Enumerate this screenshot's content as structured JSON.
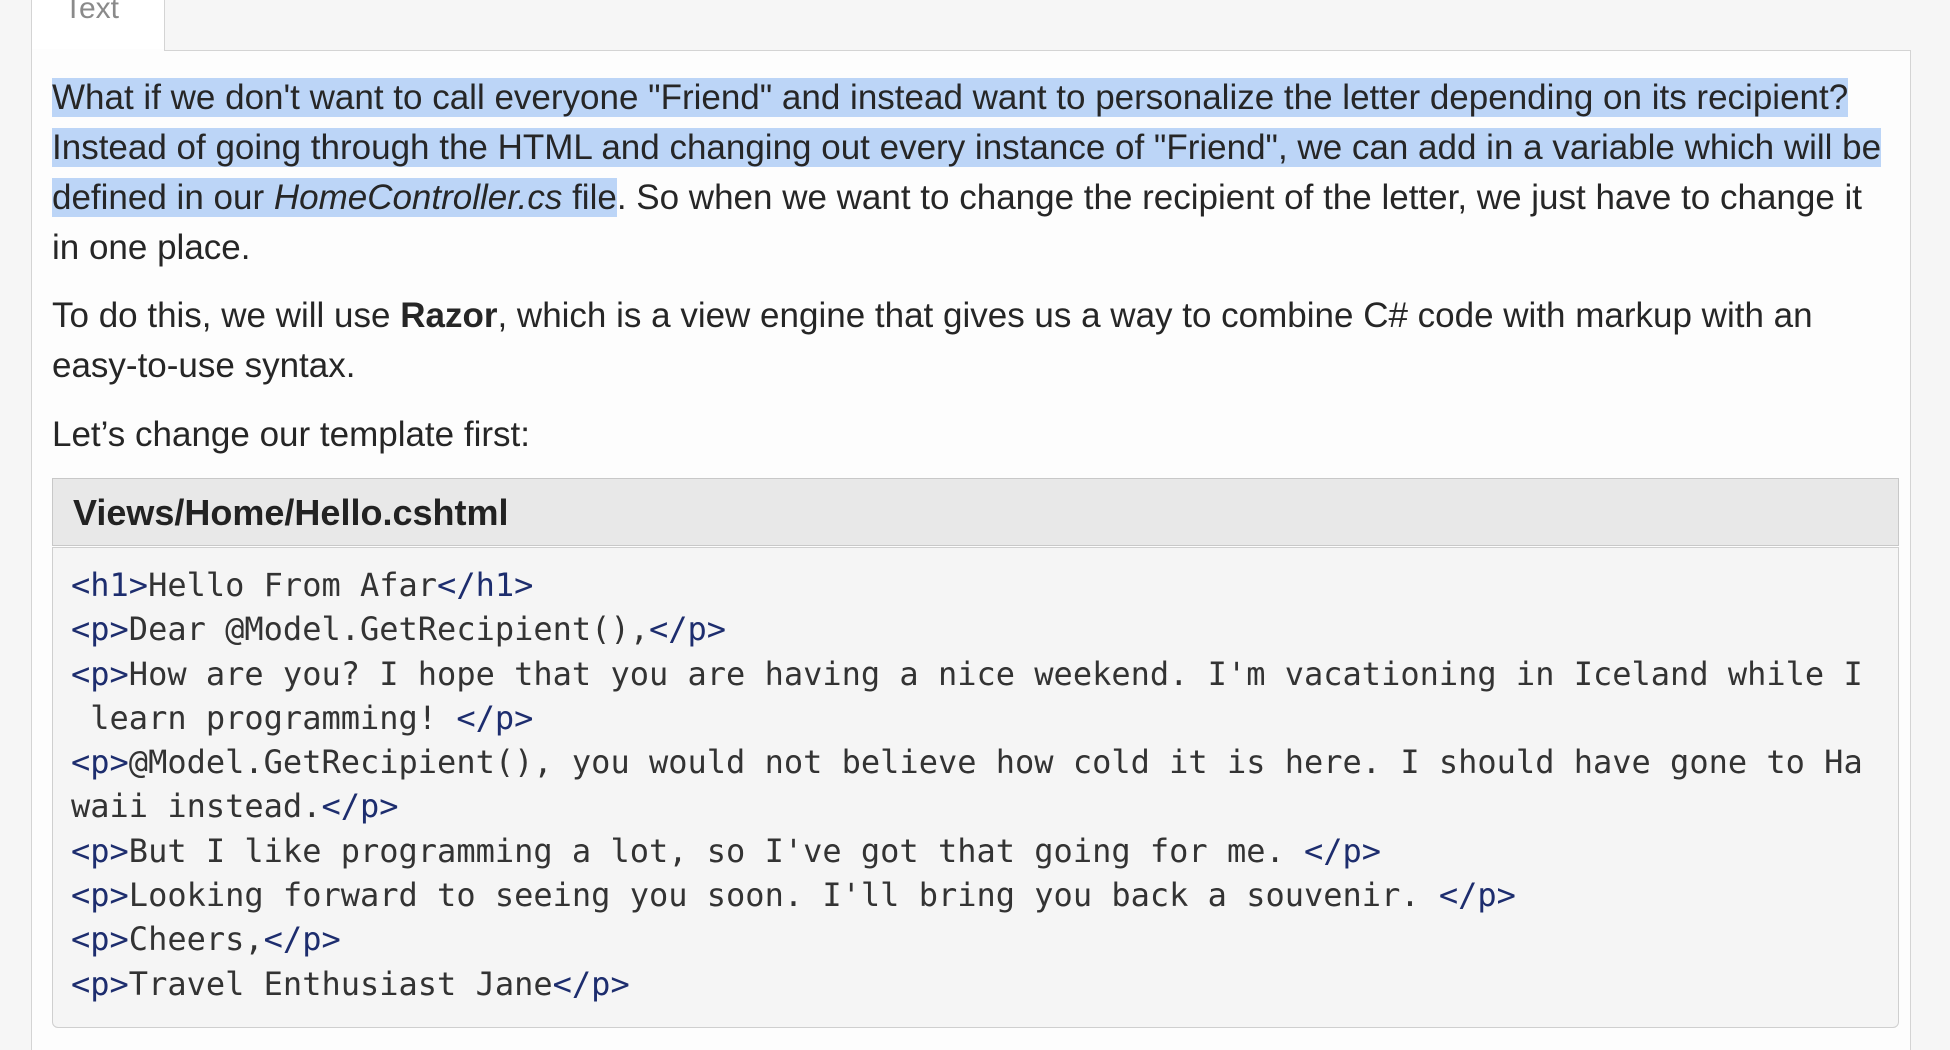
{
  "tab": {
    "label": "Text"
  },
  "content": {
    "p1": {
      "highlighted": "What if we don't want to call everyone \"Friend\" and instead want to personalize the letter depending on its recipient? Instead of going through the HTML and changing out every instance of \"Friend\", we can add in a variable which will be defined in our ",
      "file_ref": "HomeController.cs",
      "highlighted_end": " file",
      "rest": ". So when we want to change the recipient of the letter, we just have to change it in one place."
    },
    "p2": {
      "before": "To do this, we will use ",
      "bold": "Razor",
      "after": ", which is a view engine that gives us a way to combine C# code with markup with an easy-to-use syntax."
    },
    "p3": {
      "text": "Let’s change our template first:"
    }
  },
  "code_block": {
    "filename": "Views/Home/Hello.cshtml",
    "lines": [
      {
        "open": "<h1>",
        "body": "Hello From Afar",
        "close": "</h1>"
      },
      {
        "open": "<p>",
        "body": "Dear @Model.GetRecipient(),",
        "close": "</p>"
      },
      {
        "open": "<p>",
        "body": "How are you? I hope that you are having a nice weekend. I'm vacationing in Iceland while I",
        "close": ""
      },
      {
        "open": "",
        "body": " learn programming! ",
        "close": "</p>"
      },
      {
        "open": "<p>",
        "body": "@Model.GetRecipient(), you would not believe how cold it is here. I should have gone to Ha",
        "close": ""
      },
      {
        "open": "",
        "body": "waii instead.",
        "close": "</p>"
      },
      {
        "open": "<p>",
        "body": "But I like programming a lot, so I've got that going for me. ",
        "close": "</p>"
      },
      {
        "open": "<p>",
        "body": "Looking forward to seeing you soon. I'll bring you back a souvenir. ",
        "close": "</p>"
      },
      {
        "open": "<p>",
        "body": "Cheers,",
        "close": "</p>"
      },
      {
        "open": "<p>",
        "body": "Travel Enthusiast Jane",
        "close": "</p>"
      }
    ]
  }
}
